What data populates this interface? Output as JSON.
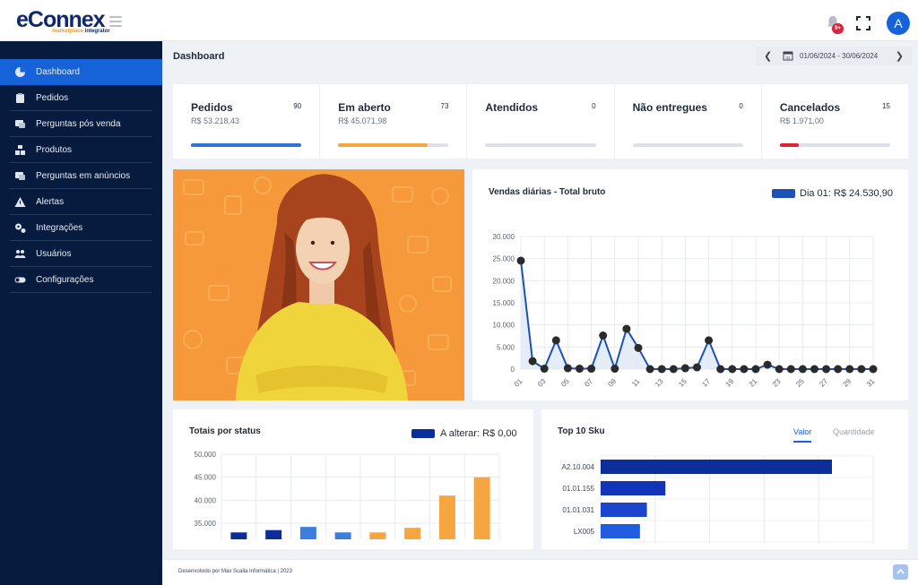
{
  "brand": {
    "name": "eConnex",
    "tag_a": "marketplace",
    "tag_b": "integrator"
  },
  "header": {
    "notification_badge": "9+",
    "avatar_letter": "A"
  },
  "sidebar": {
    "items": [
      {
        "label": "Dashboard",
        "icon": "pie-chart-icon",
        "active": true
      },
      {
        "label": "Pedidos",
        "icon": "clipboard-icon"
      },
      {
        "label": "Perguntas pós venda",
        "icon": "chat-dollar-icon"
      },
      {
        "label": "Produtos",
        "icon": "boxes-icon"
      },
      {
        "label": "Perguntas em anúncios",
        "icon": "chat-question-icon"
      },
      {
        "label": "Alertas",
        "icon": "warning-icon"
      },
      {
        "label": "Integrações",
        "icon": "gears-icon"
      },
      {
        "label": "Usuários",
        "icon": "users-icon"
      },
      {
        "label": "Configurações",
        "icon": "toggle-icon"
      }
    ]
  },
  "page": {
    "title": "Dashboard",
    "date_range": "01/06/2024 - 30/06/2024"
  },
  "stats": [
    {
      "label": "Pedidos",
      "count": "90",
      "amount": "R$ 53.218,43",
      "progress": 1.0,
      "color": "#2f73d4"
    },
    {
      "label": "Em aberto",
      "count": "73",
      "amount": "R$ 45.071,98",
      "progress": 0.81,
      "color": "#f6a53f"
    },
    {
      "label": "Atendidos",
      "count": "0",
      "amount": "",
      "progress": 0,
      "color": "#2f73d4"
    },
    {
      "label": "Não entregues",
      "count": "0",
      "amount": "",
      "progress": 0,
      "color": "#2f73d4"
    },
    {
      "label": "Cancelados",
      "count": "15",
      "amount": "R$ 1.971,00",
      "progress": 0.17,
      "color": "#d9243a"
    }
  ],
  "chart_data": [
    {
      "type": "line",
      "title": "Vendas diárias - Total bruto",
      "legend": "Dia 01: R$ 24.530,90",
      "x": [
        "01",
        "02",
        "03",
        "04",
        "05",
        "06",
        "07",
        "08",
        "09",
        "10",
        "11",
        "12",
        "13",
        "14",
        "15",
        "16",
        "17",
        "18",
        "19",
        "20",
        "21",
        "22",
        "23",
        "24",
        "25",
        "26",
        "27",
        "28",
        "29",
        "30",
        "31"
      ],
      "tick_labels": [
        "01",
        "03",
        "05",
        "07",
        "09",
        "11",
        "13",
        "15",
        "17",
        "19",
        "21",
        "23",
        "25",
        "27",
        "29",
        "31"
      ],
      "values": [
        24530.9,
        1800,
        100,
        6500,
        200,
        100,
        100,
        7600,
        100,
        9100,
        4800,
        0,
        0,
        0,
        200,
        400,
        6500,
        0,
        0,
        0,
        0,
        1000,
        0,
        0,
        0,
        0,
        0,
        0,
        0,
        0,
        0
      ],
      "y_ticks": [
        "0",
        "5.000",
        "10.000",
        "15.000",
        "20.000",
        "25.000",
        "30.000"
      ],
      "ylim": [
        0,
        30000
      ],
      "grid": true,
      "color": "#1b51b8"
    },
    {
      "type": "bar",
      "title": "Totais por status",
      "legend": "A alterar: R$ 0,00",
      "values": [
        33000,
        33500,
        34200,
        33000,
        33000,
        34000,
        41000,
        45000
      ],
      "colors": [
        "#0c2e9a",
        "#0c2e9a",
        "#3b7ee0",
        "#3b7ee0",
        "#f6a53f",
        "#f6a53f",
        "#f6a53f",
        "#f6a53f"
      ],
      "y_ticks": [
        "35.000",
        "40.000",
        "45.000",
        "50.000"
      ],
      "ylim": [
        31500,
        50000
      ],
      "grid": true
    },
    {
      "type": "bar",
      "orientation": "horizontal",
      "title": "Top 10 Sku",
      "categories": [
        "A2.10.004",
        "01.01.155",
        "01.01.031",
        "LX005"
      ],
      "values": [
        100,
        28,
        20,
        17
      ],
      "colors": [
        "#0c2e9a",
        "#1234b8",
        "#1a46cf",
        "#1f5ee0"
      ],
      "grid": true
    }
  ],
  "top_sku": {
    "tabs": [
      "Valor",
      "Quantidade"
    ],
    "active_tab": "Valor"
  },
  "footer": {
    "text": "Desenvolvido por Max Scalla Informática | 2023"
  }
}
